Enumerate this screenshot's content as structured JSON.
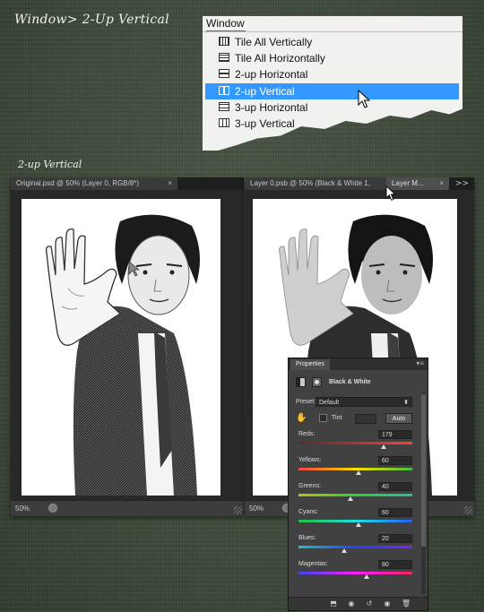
{
  "heading": "Window> 2-Up Vertical",
  "subheading": "2-up Vertical",
  "menu": {
    "title": "Window",
    "items": [
      {
        "label": "Tile All Vertically",
        "icon": "tile-vertical-icon"
      },
      {
        "label": "Tile All Horizontally",
        "icon": "tile-horizontal-icon"
      },
      {
        "label": "2-up Horizontal",
        "icon": "two-up-horizontal-icon"
      },
      {
        "label": "2-up Vertical",
        "icon": "two-up-vertical-icon",
        "highlighted": true
      },
      {
        "label": "3-up Horizontal",
        "icon": "three-up-horizontal-icon"
      },
      {
        "label": "3-up Vertical",
        "icon": "three-up-vertical-icon"
      }
    ]
  },
  "left_doc": {
    "tab_title": "Original.psd @ 50% (Layer 0, RGB/8*)",
    "close_glyph": "×",
    "zoom": "50%"
  },
  "right_doc": {
    "tab_title": "Layer 0.psb @ 50% (Black & White 1,",
    "second_tab": "Layer M...",
    "close_glyph": "×",
    "expand_glyph": ">>",
    "zoom": "50%"
  },
  "properties": {
    "tab": "Properties",
    "menu_glyph": "▾≡",
    "title": "Black & White",
    "preset_label": "Preset:",
    "preset_value": "Default",
    "tint_label": "Tint",
    "auto_label": "Auto",
    "sliders": [
      {
        "label": "Reds:",
        "value": "179",
        "fraction": 0.75,
        "gradient": [
          "#5a2a2a",
          "#ff4040"
        ]
      },
      {
        "label": "Yellows:",
        "value": "60",
        "fraction": 0.53,
        "gradient": [
          "#ff4040",
          "#ffe000",
          "#40c040"
        ]
      },
      {
        "label": "Greens:",
        "value": "40",
        "fraction": 0.46,
        "gradient": [
          "#c0c000",
          "#30d030",
          "#20c0a0"
        ]
      },
      {
        "label": "Cyans:",
        "value": "60",
        "fraction": 0.53,
        "gradient": [
          "#20c040",
          "#20e0e0",
          "#2060ff"
        ]
      },
      {
        "label": "Blues:",
        "value": "20",
        "fraction": 0.4,
        "gradient": [
          "#20c0c0",
          "#2040ff",
          "#8020ff"
        ]
      },
      {
        "label": "Magentas:",
        "value": "80",
        "fraction": 0.6,
        "gradient": [
          "#4040ff",
          "#ff20ff",
          "#ff2060"
        ]
      }
    ]
  }
}
